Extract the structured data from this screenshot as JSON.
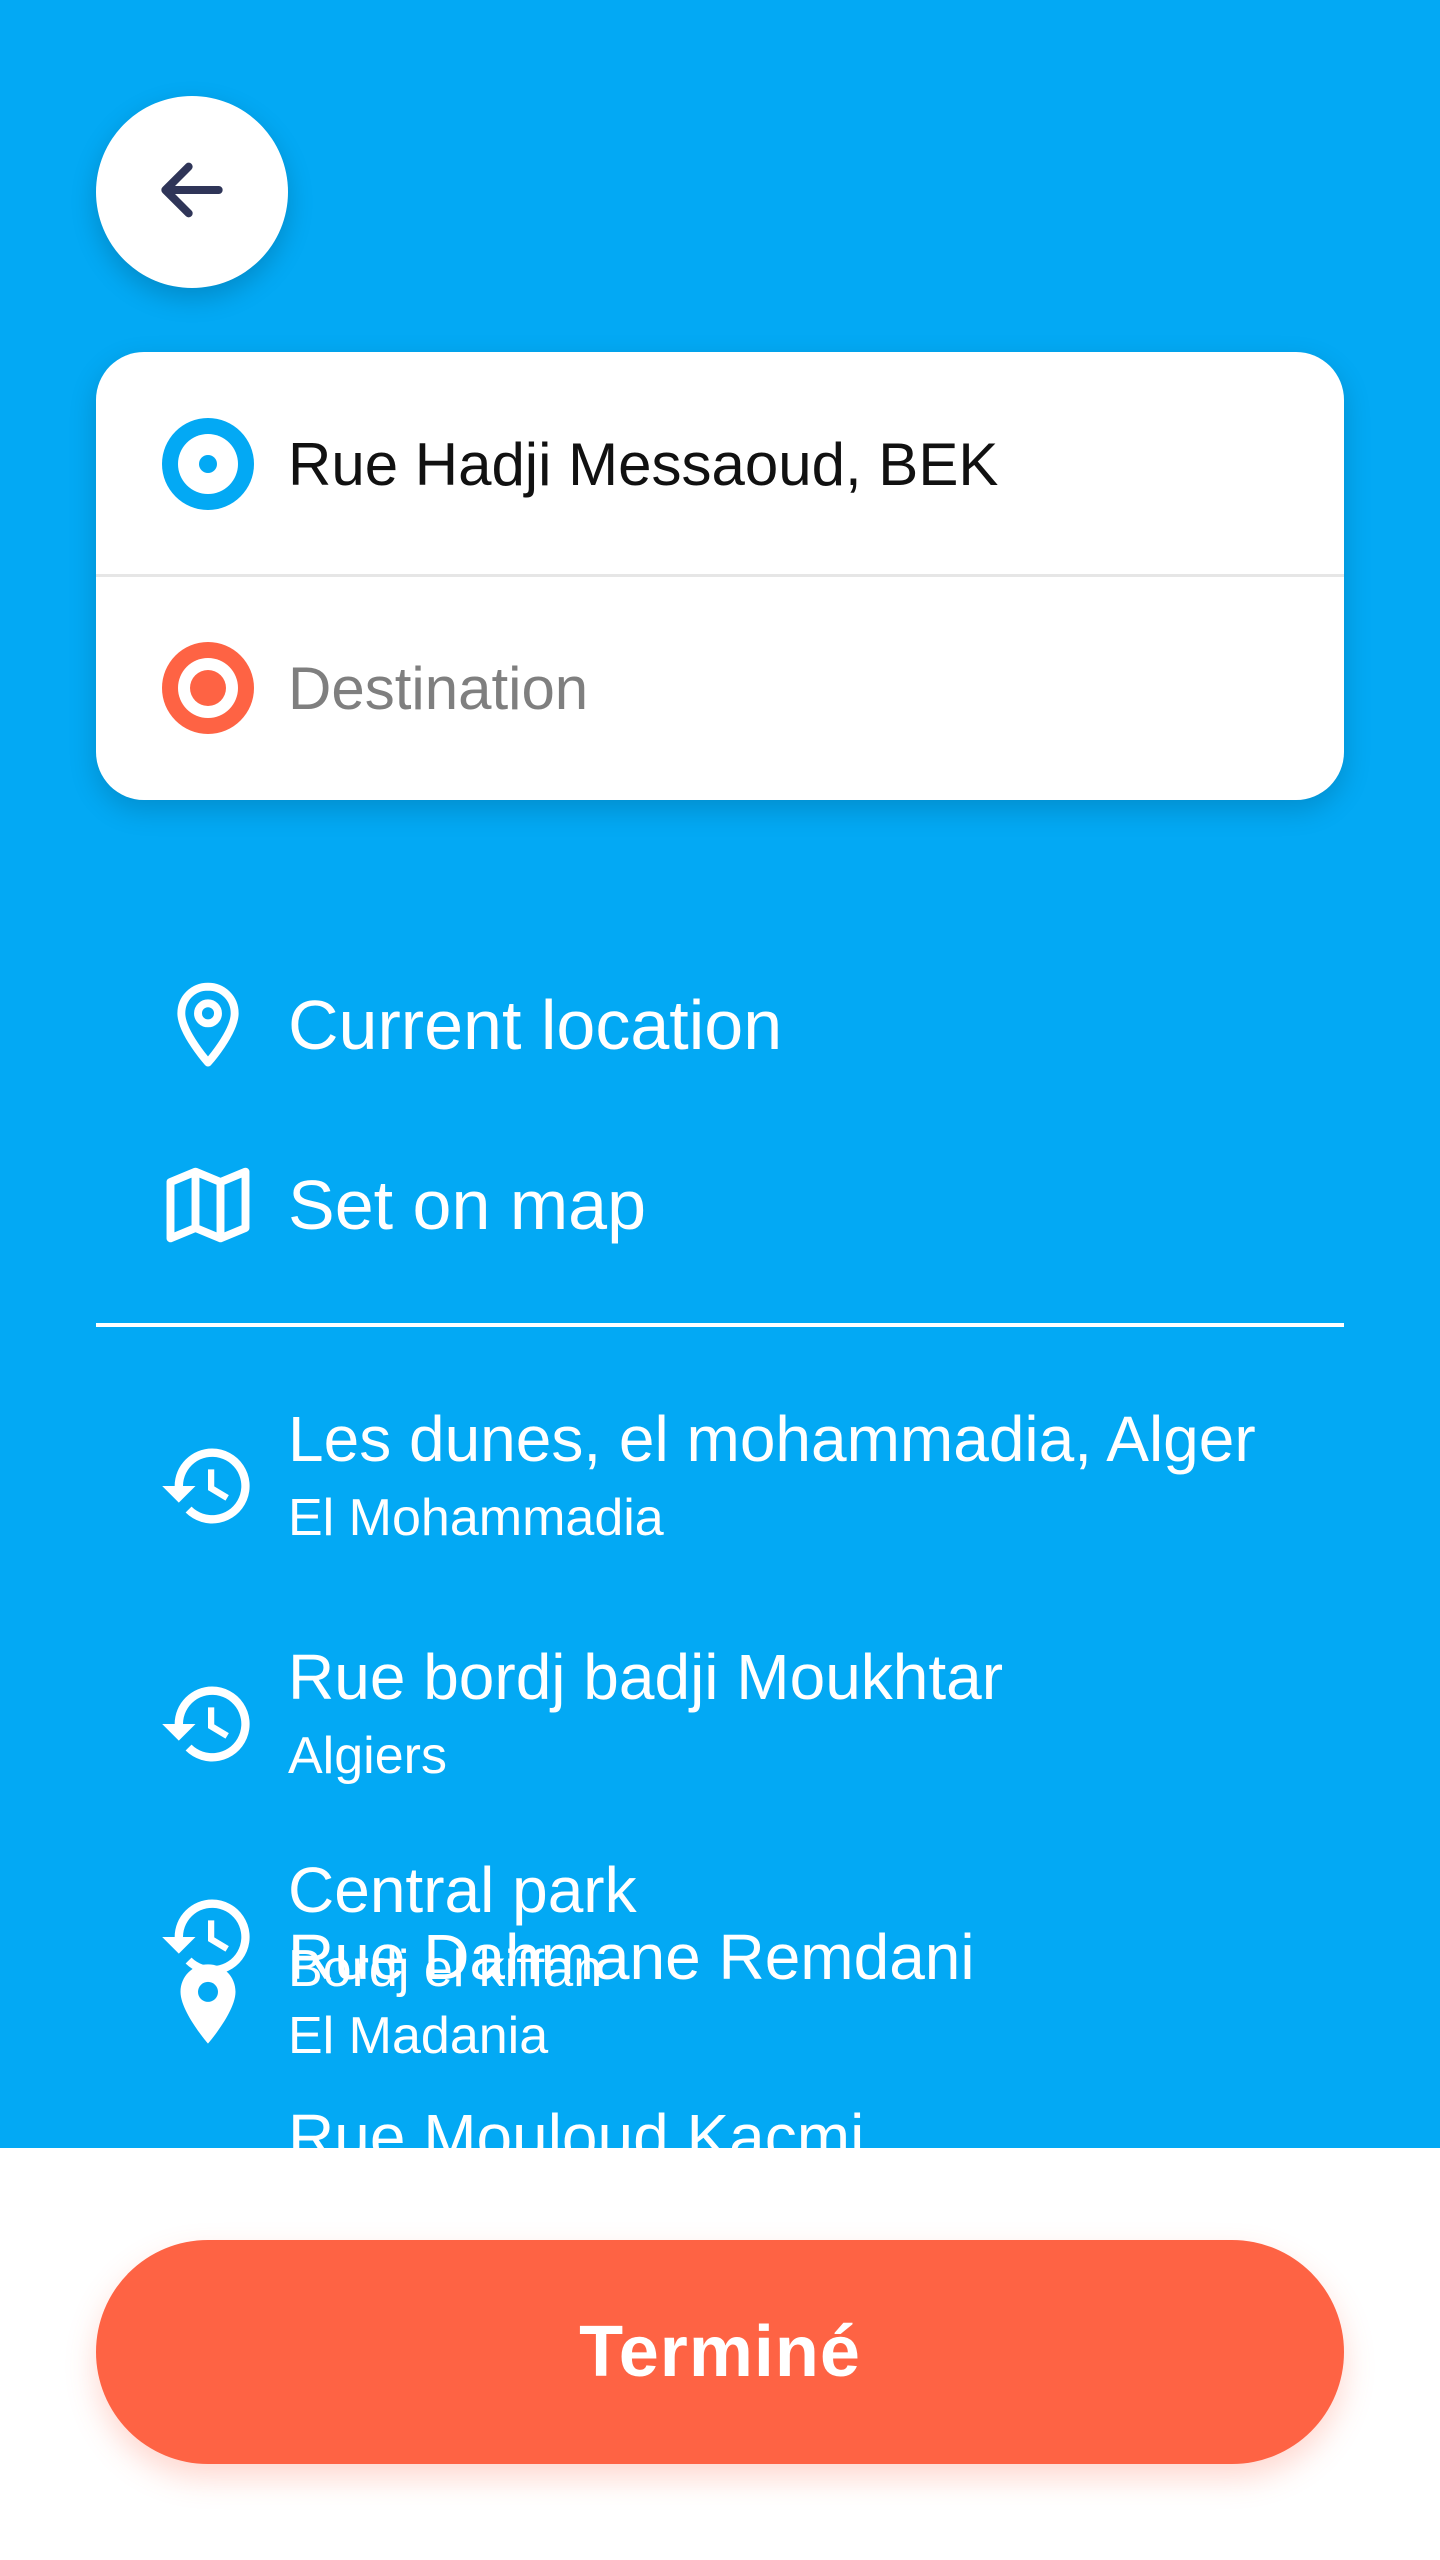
{
  "colors": {
    "primary": "#03a9f4",
    "accent": "#fe6344",
    "back_arrow": "#2f3558"
  },
  "header": {
    "back_icon": "arrow-left-icon"
  },
  "route": {
    "origin_value": "Rue Hadji Messaoud, BEK",
    "origin_icon": "origin-dot-icon",
    "destination_placeholder": "Destination",
    "destination_icon": "destination-dot-icon"
  },
  "options": [
    {
      "label": "Current location",
      "icon": "location-pin-outline-icon"
    },
    {
      "label": "Set on map",
      "icon": "map-icon"
    }
  ],
  "recent": [
    {
      "title": "Les dunes, el mohammadia, Alger",
      "subtitle": "El Mohammadia",
      "icon": "history-icon"
    },
    {
      "title": "Rue bordj badji Moukhtar",
      "subtitle": "Algiers",
      "icon": "history-icon"
    },
    {
      "title": "Central park",
      "subtitle": "Bordj el kiffan",
      "icon": "history-icon"
    },
    {
      "title": "Rue Dahmane Remdani",
      "subtitle": "El Madania",
      "icon": "location-pin-icon"
    },
    {
      "title": "Rue Mouloud Kacmi",
      "subtitle": "",
      "icon": ""
    }
  ],
  "footer": {
    "done_label": "Terminé"
  }
}
